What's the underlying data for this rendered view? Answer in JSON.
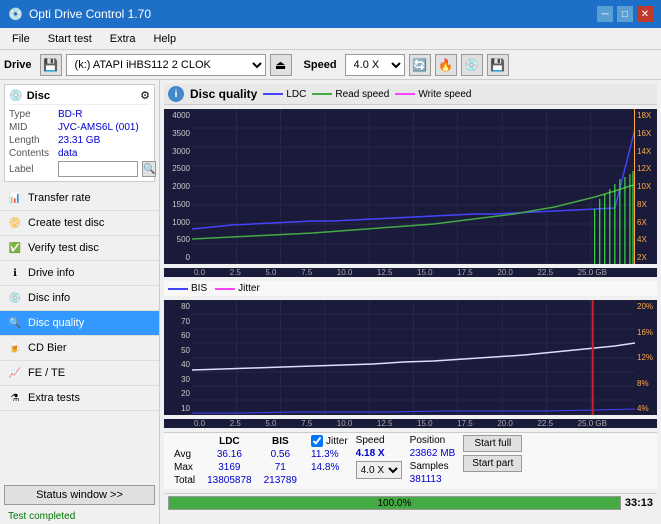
{
  "app": {
    "title": "Opti Drive Control 1.70",
    "icon": "💿"
  },
  "titlebar": {
    "minimize": "─",
    "maximize": "□",
    "close": "✕"
  },
  "menu": {
    "items": [
      "File",
      "Start test",
      "Extra",
      "Help"
    ]
  },
  "drive_toolbar": {
    "drive_label": "Drive",
    "drive_value": "(k:) ATAPI iHBS112  2 CLOK",
    "speed_label": "Speed",
    "speed_value": "4.0 X"
  },
  "disc": {
    "header": "Disc",
    "type_label": "Type",
    "type_value": "BD-R",
    "mid_label": "MID",
    "mid_value": "JVC-AMS6L (001)",
    "length_label": "Length",
    "length_value": "23.31 GB",
    "contents_label": "Contents",
    "contents_value": "data",
    "label_label": "Label",
    "label_value": ""
  },
  "nav": {
    "items": [
      {
        "id": "transfer-rate",
        "label": "Transfer rate",
        "active": false
      },
      {
        "id": "create-test-disc",
        "label": "Create test disc",
        "active": false
      },
      {
        "id": "verify-test-disc",
        "label": "Verify test disc",
        "active": false
      },
      {
        "id": "drive-info",
        "label": "Drive info",
        "active": false
      },
      {
        "id": "disc-info",
        "label": "Disc info",
        "active": false
      },
      {
        "id": "disc-quality",
        "label": "Disc quality",
        "active": true
      },
      {
        "id": "cd-bier",
        "label": "CD Bier",
        "active": false
      },
      {
        "id": "fe-te",
        "label": "FE / TE",
        "active": false
      },
      {
        "id": "extra-tests",
        "label": "Extra tests",
        "active": false
      }
    ]
  },
  "status_window_btn": "Status window >>",
  "status_text": "Test completed",
  "quality_panel": {
    "title": "Disc quality",
    "legend": {
      "ldc": "LDC",
      "read": "Read speed",
      "write": "Write speed"
    },
    "chart_top": {
      "y_labels_left": [
        "4000",
        "3500",
        "3000",
        "2500",
        "2000",
        "1500",
        "1000",
        "500",
        "0"
      ],
      "y_labels_right": [
        "18X",
        "16X",
        "14X",
        "12X",
        "10X",
        "8X",
        "6X",
        "4X",
        "2X"
      ],
      "x_labels": [
        "0.0",
        "2.5",
        "5.0",
        "7.5",
        "10.0",
        "12.5",
        "15.0",
        "17.5",
        "20.0",
        "22.5",
        "25.0 GB"
      ]
    },
    "chart_bottom": {
      "legend_bis": "BIS",
      "legend_jitter": "Jitter",
      "y_labels_left": [
        "80",
        "70",
        "60",
        "50",
        "40",
        "30",
        "20",
        "10"
      ],
      "y_labels_right": [
        "20%",
        "16%",
        "12%",
        "8%",
        "4%"
      ],
      "x_labels": [
        "0.0",
        "2.5",
        "5.0",
        "7.5",
        "10.0",
        "12.5",
        "15.0",
        "17.5",
        "20.0",
        "22.5",
        "25.0 GB"
      ]
    }
  },
  "stats": {
    "columns": [
      "",
      "LDC",
      "BIS",
      "",
      "Jitter",
      "Speed",
      ""
    ],
    "rows": [
      {
        "label": "Avg",
        "ldc": "36.16",
        "bis": "0.56",
        "jitter": "11.3%",
        "speed": "4.18 X"
      },
      {
        "label": "Max",
        "ldc": "3169",
        "bis": "71",
        "jitter": "14.8%",
        "position_label": "Position",
        "position_val": "23862 MB"
      },
      {
        "label": "Total",
        "ldc": "13805878",
        "bis": "213789",
        "jitter": "",
        "samples_label": "Samples",
        "samples_val": "381113"
      }
    ],
    "speed_select": "4.0 X",
    "jitter_checked": true
  },
  "buttons": {
    "start_full": "Start full",
    "start_part": "Start part"
  },
  "progress": {
    "value": 100,
    "text": "100.0%",
    "time": "33:13"
  }
}
